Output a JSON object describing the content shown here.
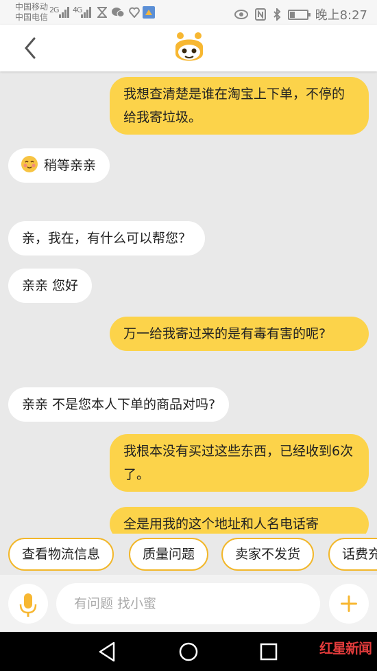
{
  "status_bar": {
    "carrier1": "中国移动",
    "carrier2": "中国电信",
    "net1": "2G",
    "net2": "4G",
    "time": "晚上8:27"
  },
  "header": {
    "back_icon": "chevron-left-icon",
    "logo": "xiaomi-assistant-logo"
  },
  "messages": [
    {
      "side": "right",
      "text": "我想查清楚是谁在淘宝上下单，不停的给我寄垃圾。"
    },
    {
      "side": "left",
      "text": "稍等亲亲",
      "emoji": "blush-emoji"
    },
    {
      "side": "left",
      "text": "亲，我在，有什么可以帮您？"
    },
    {
      "side": "left",
      "text": "亲亲 您好"
    },
    {
      "side": "right",
      "text": "万一给我寄过来的是有毒有害的呢?"
    },
    {
      "side": "left",
      "text": "亲亲 不是您本人下单的商品对吗?"
    },
    {
      "side": "right",
      "text": "我根本没有买过这些东西，已经收到6次了。"
    },
    {
      "side": "right",
      "text": "全是用我的这个地址和人名电话寄"
    }
  ],
  "quick_replies": [
    "查看物流信息",
    "质量问题",
    "卖家不发货",
    "话费充"
  ],
  "input": {
    "placeholder": "有问题 找小蜜"
  },
  "watermark": "红星新闻",
  "colors": {
    "accent_yellow": "#fcd34a",
    "chip_border": "#f2b72a",
    "background": "#e9e9e9"
  }
}
